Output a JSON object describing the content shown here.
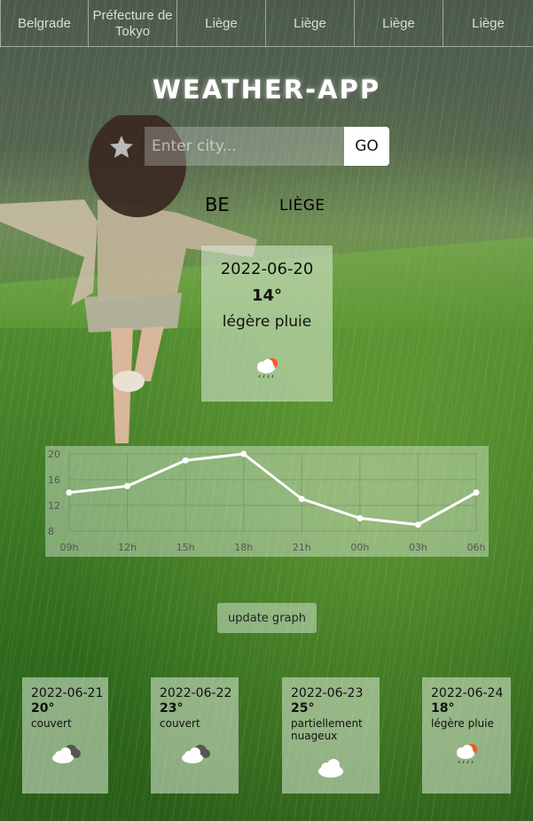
{
  "tabs": [
    "Belgrade",
    "Préfecture de Tokyo",
    "Liège",
    "Liège",
    "Liège",
    "Liège"
  ],
  "app_title": "WEATHER-APP",
  "search": {
    "placeholder": "Enter city...",
    "value": "",
    "button_label": "GO"
  },
  "location": {
    "country": "BE",
    "city": "LIÈGE"
  },
  "current": {
    "date": "2022-06-20",
    "temp": "14°",
    "description": "légère pluie",
    "icon": "light-rain-icon"
  },
  "update_button_label": "update graph",
  "chart_data": {
    "type": "line",
    "categories": [
      "09h",
      "12h",
      "15h",
      "18h",
      "21h",
      "00h",
      "03h",
      "06h"
    ],
    "values": [
      14,
      15,
      19,
      20,
      13,
      10,
      9,
      14
    ],
    "yticks": [
      20,
      16,
      12,
      8
    ],
    "ylim": [
      8,
      20
    ],
    "line_color": "#ffffff",
    "grid": true
  },
  "forecast": [
    {
      "date": "2022-06-21",
      "temp": "20°",
      "description": "couvert",
      "icon": "overcast-icon"
    },
    {
      "date": "2022-06-22",
      "temp": "23°",
      "description": "couvert",
      "icon": "overcast-icon"
    },
    {
      "date": "2022-06-23",
      "temp": "25°",
      "description": "partiellement nuageux",
      "icon": "cloud-icon"
    },
    {
      "date": "2022-06-24",
      "temp": "18°",
      "description": "légère pluie",
      "icon": "light-rain-icon"
    }
  ]
}
